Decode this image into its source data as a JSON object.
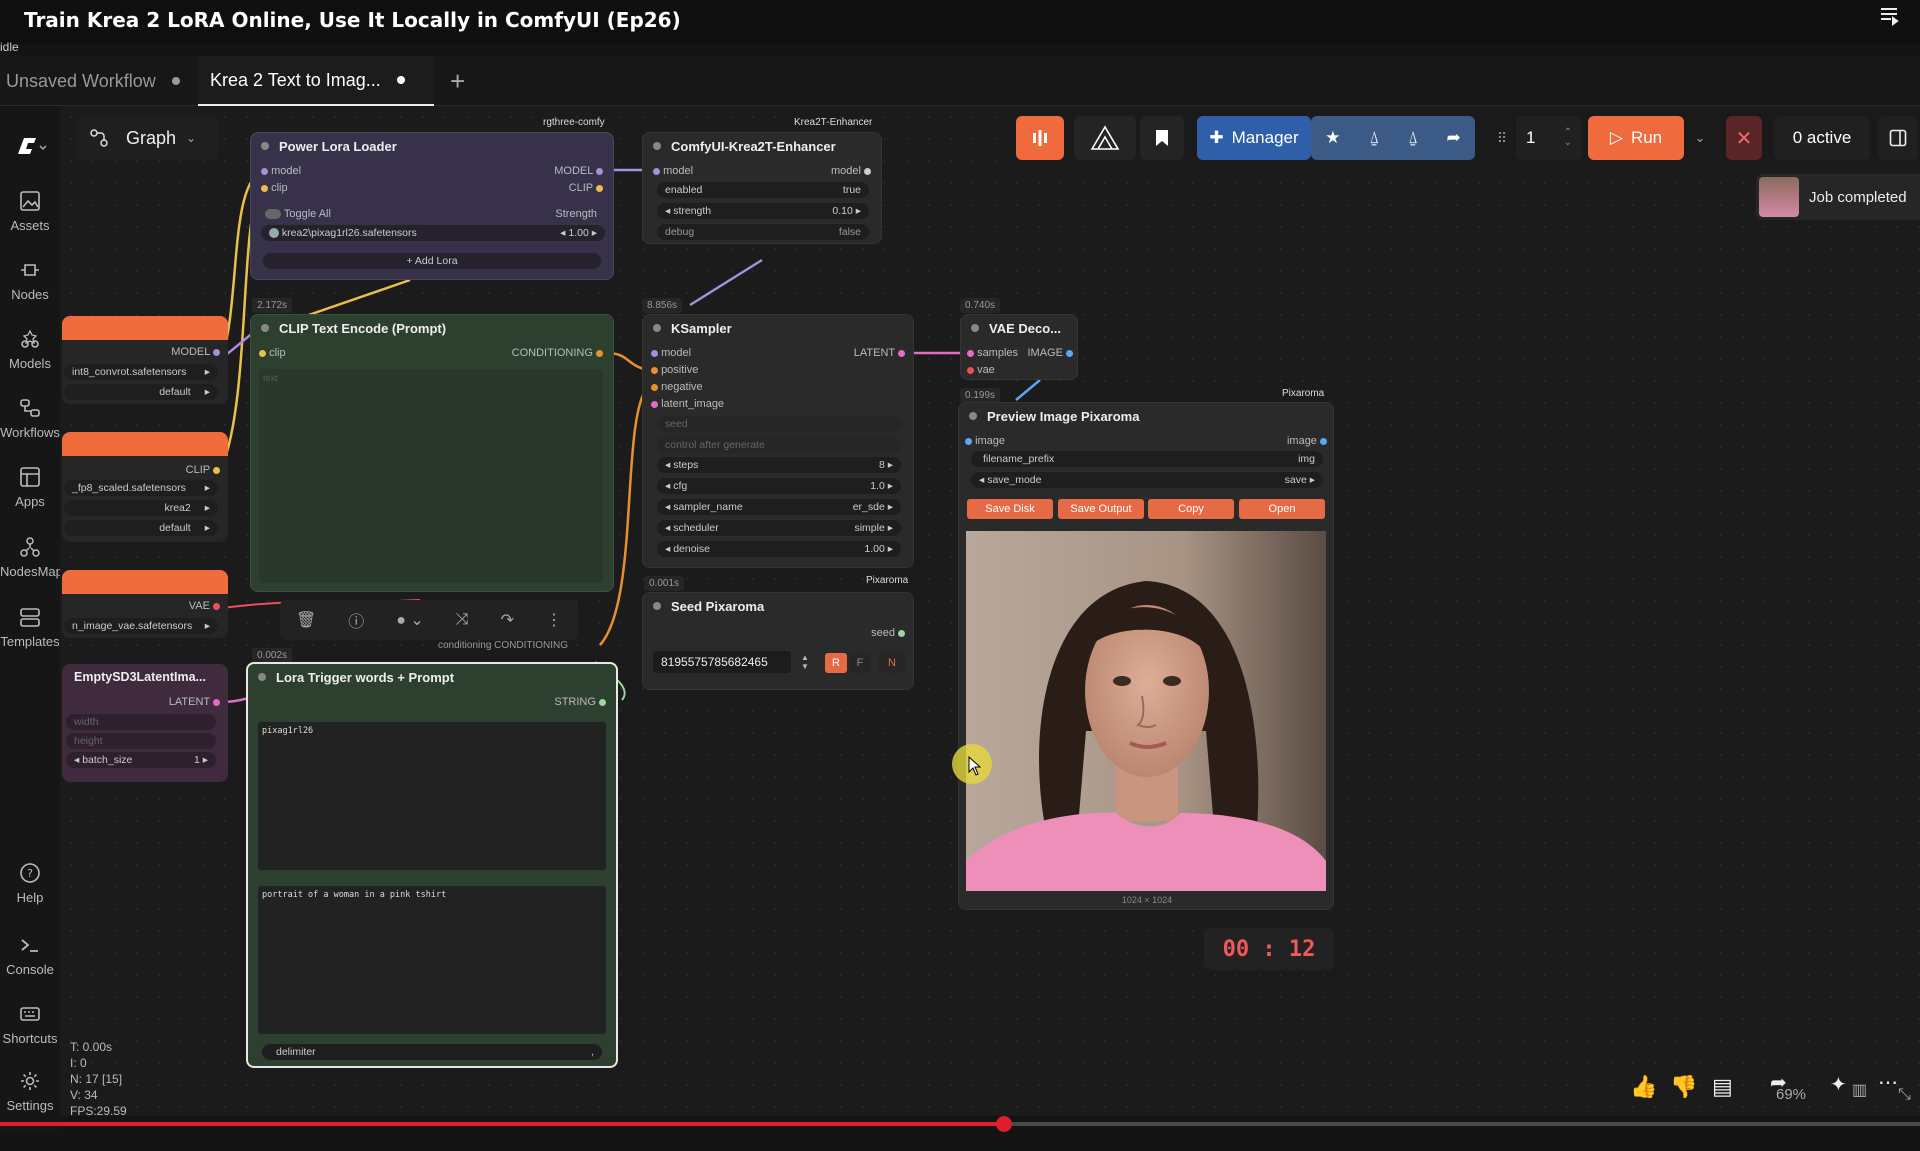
{
  "video": {
    "title": "Train Krea 2 LoRA Online, Use It Locally in ComfyUI (Ep26)",
    "status": "idle",
    "list_icon": "list-icon"
  },
  "tabs": [
    {
      "label": "Unsaved Workflow"
    },
    {
      "label": "Krea 2 Text to Imag..."
    }
  ],
  "sidebar": {
    "items": [
      {
        "label": "Assets",
        "icon": "image-icon"
      },
      {
        "label": "Nodes",
        "icon": "node-icon"
      },
      {
        "label": "Models",
        "icon": "models-icon"
      },
      {
        "label": "Workflows",
        "icon": "workflow-icon"
      },
      {
        "label": "Apps",
        "icon": "apps-icon"
      },
      {
        "label": "NodesMap",
        "icon": "map-icon"
      },
      {
        "label": "Templates",
        "icon": "templates-icon"
      },
      {
        "label": "Help",
        "icon": "help-icon"
      },
      {
        "label": "Console",
        "icon": "console-icon"
      },
      {
        "label": "Shortcuts",
        "icon": "keyboard-icon"
      },
      {
        "label": "Settings",
        "icon": "gear-icon"
      }
    ]
  },
  "graph_button": "Graph",
  "toolbar": {
    "manager": "Manager",
    "queue_count": "1",
    "run": "Run",
    "active": "0 active"
  },
  "toast": "Job completed",
  "nodes": {
    "power_lora": {
      "group": "rgthree-comfy",
      "title": "Power Lora Loader",
      "in_model": "model",
      "in_clip": "clip",
      "out_model": "MODEL",
      "out_clip": "CLIP",
      "toggle_all": "Toggle All",
      "strength_header": "Strength",
      "lora_name": "krea2\\pixag1rl26.safetensors",
      "lora_strength": "1.00",
      "add_lora": "+ Add Lora",
      "timing": "2.172s"
    },
    "enhancer": {
      "group": "Krea2T-Enhancer",
      "title": "ComfyUI-Krea2T-Enhancer",
      "in_model": "model",
      "out_model": "model",
      "enabled_label": "enabled",
      "enabled_value": "true",
      "strength_label": "strength",
      "strength_value": "0.10",
      "debug_label": "debug",
      "debug_value": "false",
      "timing": "8.856s"
    },
    "clip_text": {
      "title": "CLIP Text Encode (Prompt)",
      "in_clip": "clip",
      "out_cond": "CONDITIONING",
      "text_placeholder": "text"
    },
    "ksampler": {
      "title": "KSampler",
      "in_model": "model",
      "in_pos": "positive",
      "in_neg": "negative",
      "in_latent": "latent_image",
      "out": "LATENT",
      "seed": "seed",
      "control": "control after generate",
      "steps_label": "steps",
      "steps": "8",
      "cfg_label": "cfg",
      "cfg": "1.0",
      "sampler_label": "sampler_name",
      "sampler": "er_sde",
      "scheduler_label": "scheduler",
      "scheduler": "simple",
      "denoise_label": "denoise",
      "denoise": "1.00",
      "timing": "0.740s"
    },
    "vae_decode": {
      "title": "VAE Deco...",
      "in_samples": "samples",
      "in_vae": "vae",
      "out": "IMAGE",
      "timing": "0.199s"
    },
    "preview": {
      "group": "Pixaroma",
      "title": "Preview Image Pixaroma",
      "in": "image",
      "out": "image",
      "prefix_label": "filename_prefix",
      "prefix": "img",
      "mode_label": "save_mode",
      "mode": "save",
      "btn_save_disk": "Save Disk",
      "btn_save_output": "Save Output",
      "btn_copy": "Copy",
      "btn_open": "Open",
      "size": "1024 × 1024"
    },
    "seed": {
      "group": "Pixaroma",
      "title": "Seed Pixaroma",
      "out": "seed",
      "value": "819557578568246​5",
      "r": "R",
      "f": "F",
      "n": "N",
      "timing": "0.001s"
    },
    "lora_trigger": {
      "title": "Lora Trigger words + Prompt",
      "out": "STRING",
      "trigger": "pixag1rl26",
      "prompt": "portrait of a woman in a pink tshirt",
      "delimiter_label": "delimiter",
      "delimiter": ",",
      "timing": "0.002s",
      "conditioning": "conditioning CONDITIONING"
    },
    "left_model": {
      "out": "MODEL",
      "file": "int8_convrot.safetensors",
      "dtype": "default"
    },
    "left_clip": {
      "out": "CLIP",
      "file": "_fp8_scaled.safetensors",
      "type": "krea2",
      "device": "default"
    },
    "left_vae": {
      "out": "VAE",
      "file": "n_image_vae.safetensors"
    },
    "empty_latent": {
      "title": "EmptySD3LatentIma...",
      "out": "LATENT",
      "width": "width",
      "height": "height",
      "batch_label": "batch_size",
      "batch": "1"
    }
  },
  "timer": "00 : 12",
  "stats": {
    "t": "T: 0.00s",
    "i": "I: 0",
    "n": "N: 17 [15]",
    "v": "V: 34",
    "fps": "FPS:29.59"
  },
  "zoom": "69%",
  "video_progress": 0.523
}
